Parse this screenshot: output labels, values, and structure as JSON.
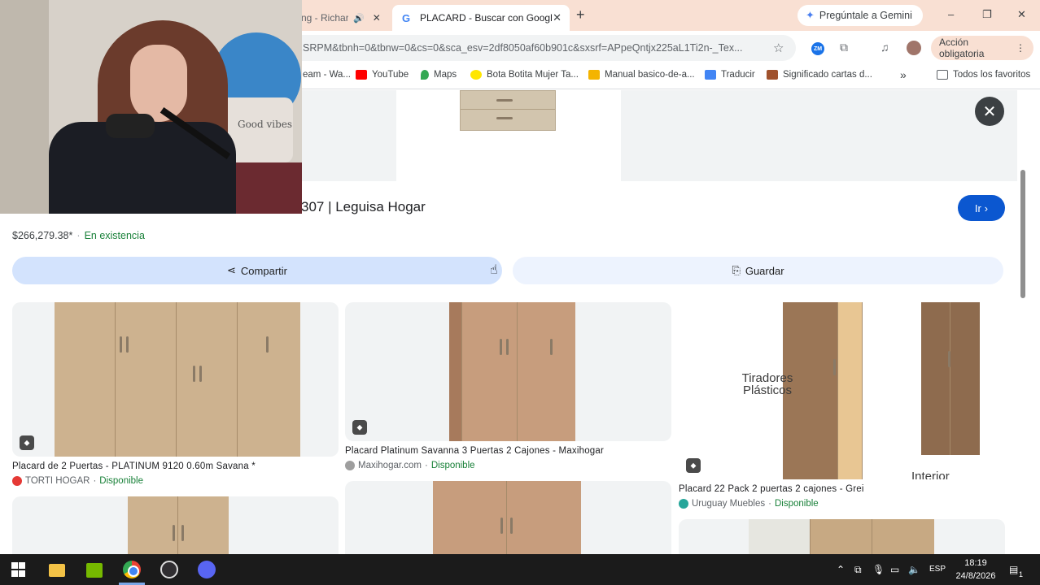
{
  "browser": {
    "tabs": [
      {
        "label": "ng - Richar",
        "active": false
      },
      {
        "label": "PLACARD - Buscar con Google",
        "active": true
      }
    ],
    "new_tab": "+",
    "gemini_label": "Pregúntale a Gemini",
    "window_controls": {
      "minimize": "–",
      "restore": "❐",
      "close": "✕"
    },
    "url": "SRPM&tbnh=0&tbnw=0&cs=0&sca_esv=2df8050af60b901c&sxsrf=APpeQntjx225aL1Ti2n-_Tex...",
    "action_button": "Acción obligatoria",
    "bookmarks": [
      {
        "label": "eam - Wa...",
        "color": "#8bc34a"
      },
      {
        "label": "YouTube",
        "color": "#ff0000"
      },
      {
        "label": "Maps",
        "color": "#34a853"
      },
      {
        "label": "Bota Botita Mujer Ta...",
        "color": "#ffe600"
      },
      {
        "label": "Manual basico-de-a...",
        "color": "#f4b400"
      },
      {
        "label": "Traducir",
        "color": "#4285f4"
      },
      {
        "label": "Significado cartas d...",
        "color": "#a0522d"
      }
    ],
    "bookmarks_more": "»",
    "all_bookmarks": "Todos los favoritos"
  },
  "product": {
    "title": "307 | Leguisa Hogar",
    "go_label": "Ir",
    "price": "$266,279.38*",
    "stock": "En existencia",
    "share_label": "Compartir",
    "save_label": "Guardar"
  },
  "results": [
    {
      "title": "Placard de 2 Puertas - PLATINUM 9120 0.60m Savana *",
      "source": "TORTI HOGAR",
      "availability": "Disponible",
      "source_color": "#e53935"
    },
    {
      "title": "Placard Platinum Savanna 3 Puertas 2 Cajones - Maxihogar",
      "source": "Maxihogar.com",
      "availability": "Disponible",
      "source_color": "#9e9e9e"
    },
    {
      "title": "Placard 22 Pack 2 puertas 2 cajones - Grei",
      "source": "Uruguay Muebles",
      "availability": "Disponible",
      "source_color": "#26a69a"
    }
  ],
  "image_texts": {
    "tiradores": "Tiradores Plásticos",
    "interior": "Interior",
    "pillow": "Good vibes"
  },
  "taskbar": {
    "language": "ESP",
    "time": "18:19",
    "date": "24/8/2026",
    "notification_count": "1"
  }
}
